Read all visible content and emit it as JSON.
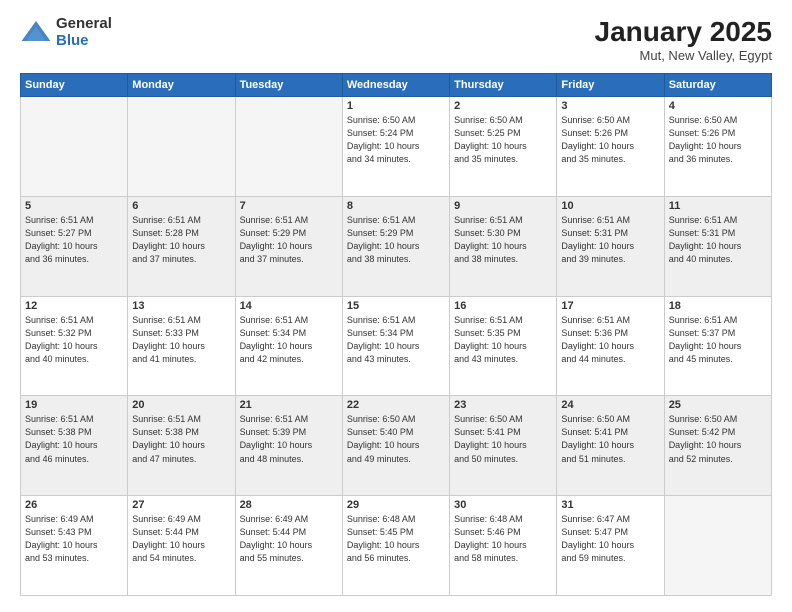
{
  "logo": {
    "general": "General",
    "blue": "Blue"
  },
  "title": "January 2025",
  "subtitle": "Mut, New Valley, Egypt",
  "days_of_week": [
    "Sunday",
    "Monday",
    "Tuesday",
    "Wednesday",
    "Thursday",
    "Friday",
    "Saturday"
  ],
  "weeks": [
    [
      {
        "day": "",
        "info": ""
      },
      {
        "day": "",
        "info": ""
      },
      {
        "day": "",
        "info": ""
      },
      {
        "day": "1",
        "info": "Sunrise: 6:50 AM\nSunset: 5:24 PM\nDaylight: 10 hours\nand 34 minutes."
      },
      {
        "day": "2",
        "info": "Sunrise: 6:50 AM\nSunset: 5:25 PM\nDaylight: 10 hours\nand 35 minutes."
      },
      {
        "day": "3",
        "info": "Sunrise: 6:50 AM\nSunset: 5:26 PM\nDaylight: 10 hours\nand 35 minutes."
      },
      {
        "day": "4",
        "info": "Sunrise: 6:50 AM\nSunset: 5:26 PM\nDaylight: 10 hours\nand 36 minutes."
      }
    ],
    [
      {
        "day": "5",
        "info": "Sunrise: 6:51 AM\nSunset: 5:27 PM\nDaylight: 10 hours\nand 36 minutes."
      },
      {
        "day": "6",
        "info": "Sunrise: 6:51 AM\nSunset: 5:28 PM\nDaylight: 10 hours\nand 37 minutes."
      },
      {
        "day": "7",
        "info": "Sunrise: 6:51 AM\nSunset: 5:29 PM\nDaylight: 10 hours\nand 37 minutes."
      },
      {
        "day": "8",
        "info": "Sunrise: 6:51 AM\nSunset: 5:29 PM\nDaylight: 10 hours\nand 38 minutes."
      },
      {
        "day": "9",
        "info": "Sunrise: 6:51 AM\nSunset: 5:30 PM\nDaylight: 10 hours\nand 38 minutes."
      },
      {
        "day": "10",
        "info": "Sunrise: 6:51 AM\nSunset: 5:31 PM\nDaylight: 10 hours\nand 39 minutes."
      },
      {
        "day": "11",
        "info": "Sunrise: 6:51 AM\nSunset: 5:31 PM\nDaylight: 10 hours\nand 40 minutes."
      }
    ],
    [
      {
        "day": "12",
        "info": "Sunrise: 6:51 AM\nSunset: 5:32 PM\nDaylight: 10 hours\nand 40 minutes."
      },
      {
        "day": "13",
        "info": "Sunrise: 6:51 AM\nSunset: 5:33 PM\nDaylight: 10 hours\nand 41 minutes."
      },
      {
        "day": "14",
        "info": "Sunrise: 6:51 AM\nSunset: 5:34 PM\nDaylight: 10 hours\nand 42 minutes."
      },
      {
        "day": "15",
        "info": "Sunrise: 6:51 AM\nSunset: 5:34 PM\nDaylight: 10 hours\nand 43 minutes."
      },
      {
        "day": "16",
        "info": "Sunrise: 6:51 AM\nSunset: 5:35 PM\nDaylight: 10 hours\nand 43 minutes."
      },
      {
        "day": "17",
        "info": "Sunrise: 6:51 AM\nSunset: 5:36 PM\nDaylight: 10 hours\nand 44 minutes."
      },
      {
        "day": "18",
        "info": "Sunrise: 6:51 AM\nSunset: 5:37 PM\nDaylight: 10 hours\nand 45 minutes."
      }
    ],
    [
      {
        "day": "19",
        "info": "Sunrise: 6:51 AM\nSunset: 5:38 PM\nDaylight: 10 hours\nand 46 minutes."
      },
      {
        "day": "20",
        "info": "Sunrise: 6:51 AM\nSunset: 5:38 PM\nDaylight: 10 hours\nand 47 minutes."
      },
      {
        "day": "21",
        "info": "Sunrise: 6:51 AM\nSunset: 5:39 PM\nDaylight: 10 hours\nand 48 minutes."
      },
      {
        "day": "22",
        "info": "Sunrise: 6:50 AM\nSunset: 5:40 PM\nDaylight: 10 hours\nand 49 minutes."
      },
      {
        "day": "23",
        "info": "Sunrise: 6:50 AM\nSunset: 5:41 PM\nDaylight: 10 hours\nand 50 minutes."
      },
      {
        "day": "24",
        "info": "Sunrise: 6:50 AM\nSunset: 5:41 PM\nDaylight: 10 hours\nand 51 minutes."
      },
      {
        "day": "25",
        "info": "Sunrise: 6:50 AM\nSunset: 5:42 PM\nDaylight: 10 hours\nand 52 minutes."
      }
    ],
    [
      {
        "day": "26",
        "info": "Sunrise: 6:49 AM\nSunset: 5:43 PM\nDaylight: 10 hours\nand 53 minutes."
      },
      {
        "day": "27",
        "info": "Sunrise: 6:49 AM\nSunset: 5:44 PM\nDaylight: 10 hours\nand 54 minutes."
      },
      {
        "day": "28",
        "info": "Sunrise: 6:49 AM\nSunset: 5:44 PM\nDaylight: 10 hours\nand 55 minutes."
      },
      {
        "day": "29",
        "info": "Sunrise: 6:48 AM\nSunset: 5:45 PM\nDaylight: 10 hours\nand 56 minutes."
      },
      {
        "day": "30",
        "info": "Sunrise: 6:48 AM\nSunset: 5:46 PM\nDaylight: 10 hours\nand 58 minutes."
      },
      {
        "day": "31",
        "info": "Sunrise: 6:47 AM\nSunset: 5:47 PM\nDaylight: 10 hours\nand 59 minutes."
      },
      {
        "day": "",
        "info": ""
      }
    ]
  ]
}
